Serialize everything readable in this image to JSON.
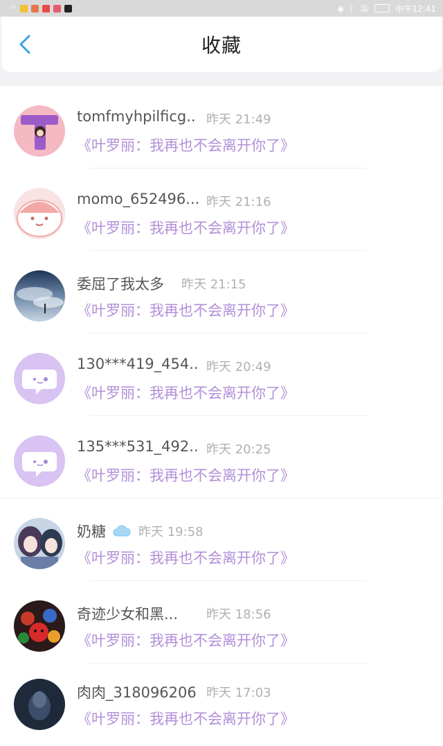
{
  "status_bar": {
    "time": "中午12:41",
    "left_icons": [
      "wifi-icon",
      "app-icon",
      "weibo-icon",
      "app-icon",
      "app-icon",
      "tiktok-icon",
      "more-dots-icon"
    ],
    "right_icons": [
      "eye-icon",
      "bluetooth-icon",
      "mute-icon",
      "battery-icon"
    ]
  },
  "header": {
    "title": "收藏",
    "back_icon": "chevron-left-icon"
  },
  "items": [
    {
      "name": "tomfmyhpilficg..",
      "time": "昨天 21:49",
      "book": "《叶罗丽：我再也不会离开你了》",
      "avatar": "letter-t-avatar"
    },
    {
      "name": "momo_652496...",
      "time": "昨天 21:16",
      "book": "《叶罗丽：我再也不会离开你了》",
      "avatar": "pink-blob-avatar"
    },
    {
      "name": "委屈了我太多",
      "time": "昨天 21:15",
      "book": "《叶罗丽：我再也不会离开你了》",
      "avatar": "sky-photo-avatar"
    },
    {
      "name": "130***419_454..",
      "time": "昨天 20:49",
      "book": "《叶罗丽：我再也不会离开你了》",
      "avatar": "default-chat-avatar"
    },
    {
      "name": "135***531_492..",
      "time": "昨天 20:25",
      "book": "《叶罗丽：我再也不会离开你了》",
      "avatar": "default-chat-avatar"
    },
    {
      "name": "奶糖",
      "time": "昨天 19:58",
      "book": "《叶罗丽：我再也不会离开你了》",
      "avatar": "anime-girls-avatar",
      "badge": "cloud-icon"
    },
    {
      "name": "奇迹少女和黑...",
      "time": "昨天 18:56",
      "book": "《叶罗丽：我再也不会离开你了》",
      "avatar": "heroes-avatar"
    },
    {
      "name": "肉肉_318096206",
      "time": "昨天 17:03",
      "book": "《叶罗丽：我再也不会离开你了》",
      "avatar": "dark-photo-avatar"
    }
  ],
  "colors": {
    "accent": "#3aa0e8",
    "book_title": "#b28fd8",
    "time": "#b0b0b0",
    "name": "#555555"
  }
}
